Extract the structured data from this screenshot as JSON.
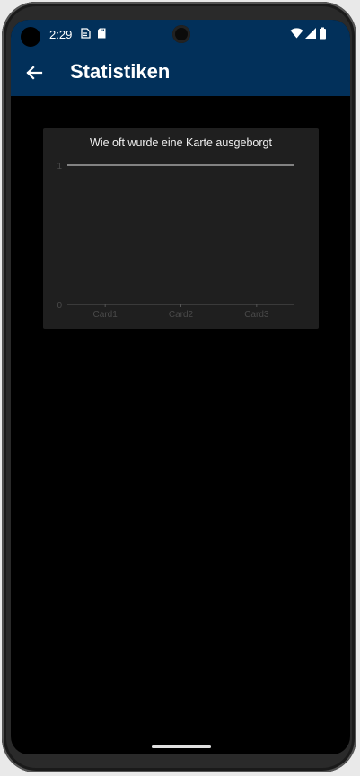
{
  "status_bar": {
    "time": "2:29",
    "icons": [
      "sim-card-icon",
      "sd-card-icon",
      "wifi-icon",
      "signal-icon",
      "battery-icon"
    ]
  },
  "app_bar": {
    "title": "Statistiken",
    "back_icon": "arrow-left-icon",
    "color": "#02305a"
  },
  "chart_data": {
    "type": "bar",
    "title": "Wie oft wurde eine Karte ausgeborgt",
    "categories": [
      "Card1",
      "Card2",
      "Card3"
    ],
    "values": [
      0,
      0,
      0
    ],
    "ylim": [
      0,
      1
    ],
    "y_ticks": [
      0,
      1
    ],
    "grid": true
  }
}
